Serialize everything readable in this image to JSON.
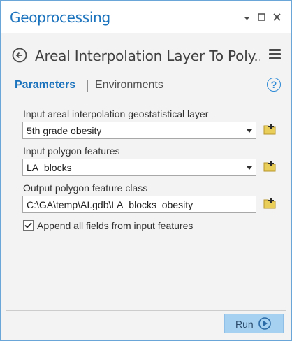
{
  "pane": {
    "title": "Geoprocessing",
    "controls": {
      "dropdown_icon": "chevron-down-icon",
      "restore_icon": "restore-icon",
      "close_icon": "close-icon"
    }
  },
  "tool": {
    "title": "Areal Interpolation Layer To Poly...",
    "back_icon": "back-arrow-icon",
    "menu_icon": "hamburger-menu-icon"
  },
  "tabs": {
    "parameters": "Parameters",
    "environments": "Environments",
    "help_icon": "?"
  },
  "params": [
    {
      "label": "Input areal interpolation geostatistical layer",
      "value": "5th grade obesity",
      "type": "dropdown"
    },
    {
      "label": "Input polygon features",
      "value": "LA_blocks",
      "type": "dropdown"
    },
    {
      "label": "Output polygon feature class",
      "value": "C:\\GA\\temp\\AI.gdb\\LA_blocks_obesity",
      "type": "text"
    }
  ],
  "append_fields": {
    "label": "Append all fields from input features",
    "checked": true
  },
  "run": {
    "label": "Run"
  },
  "colors": {
    "accent": "#1c73bd",
    "run_bg": "#a7d1f0",
    "border": "#6aa6d8"
  }
}
